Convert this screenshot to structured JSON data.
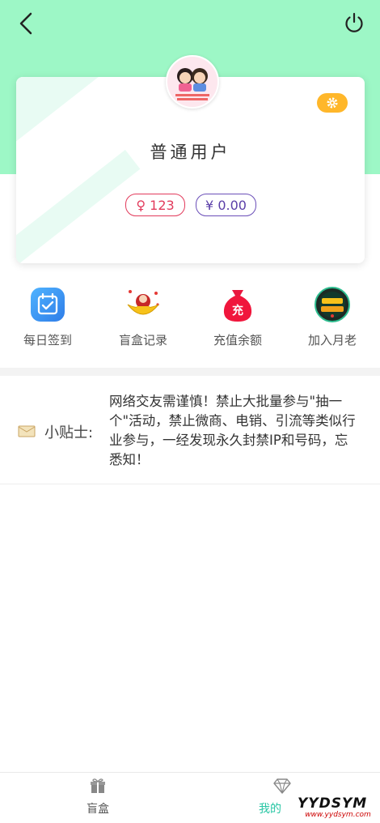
{
  "profile": {
    "username": "普通用户",
    "points_text": "♀ 123",
    "balance_text": "¥ 0.00"
  },
  "quick_actions": [
    {
      "label": "每日签到",
      "icon": "calendar-check-icon"
    },
    {
      "label": "盲盒记录",
      "icon": "gold-ingot-icon"
    },
    {
      "label": "充值余额",
      "icon": "money-bag-icon"
    },
    {
      "label": "加入月老",
      "icon": "badge-emblem-icon"
    }
  ],
  "tips": {
    "label": "小贴士:",
    "text": "网络交友需谨慎！禁止大批量参与\"抽一个\"活动，禁止微商、电销、引流等类似行业参与，一经发现永久封禁IP和号码，忘悉知！"
  },
  "tabbar": [
    {
      "label": "盲盒",
      "icon": "gift-icon",
      "active": false
    },
    {
      "label": "我的",
      "icon": "diamond-icon",
      "active": true
    }
  ],
  "colors": {
    "hero": "#9df7c6",
    "accent": "#27c6a4",
    "settings": "#ffb72a",
    "points": "#e23b5c",
    "balance": "#6b4fb8"
  }
}
